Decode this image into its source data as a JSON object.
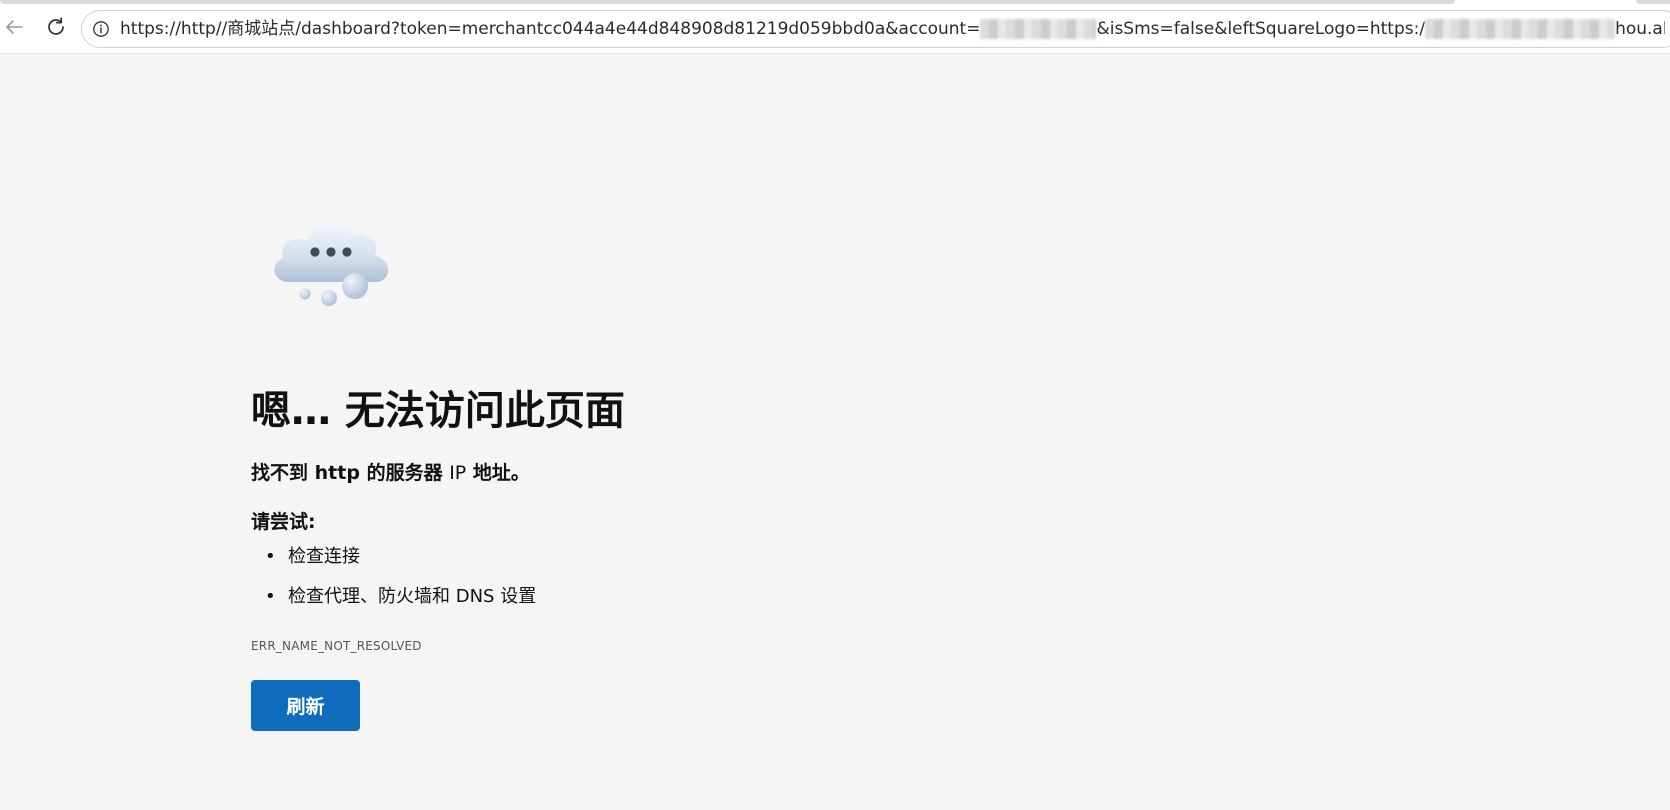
{
  "browser": {
    "url_start": "https://http//商城站点/dashboard?token=merchantcc044a4e44d848908d81219d059bbd0a&account=",
    "url_middle": "&isSms=false&leftSquareLogo=https:/",
    "url_end": "hou.aliyuncs.com/cr..."
  },
  "error_page": {
    "heading": "嗯… 无法访问此页面",
    "subtext_prefix": "找不到",
    "subtext_host": "http",
    "subtext_middle": "的服务器",
    "subtext_ip": "IP",
    "subtext_suffix": "地址。",
    "try_label": "请尝试:",
    "suggestions": [
      "检查连接",
      "检查代理、防火墙和 DNS 设置"
    ],
    "bullet": "•",
    "error_code": "ERR_NAME_NOT_RESOLVED",
    "refresh_label": "刷新"
  },
  "colors": {
    "background": "#f5f5f5",
    "primary_button": "#0f6cbd"
  },
  "icons": {
    "back": "arrow-left-icon",
    "reload": "reload-icon",
    "site_info": "info-icon",
    "illustration": "cloud-icon"
  }
}
